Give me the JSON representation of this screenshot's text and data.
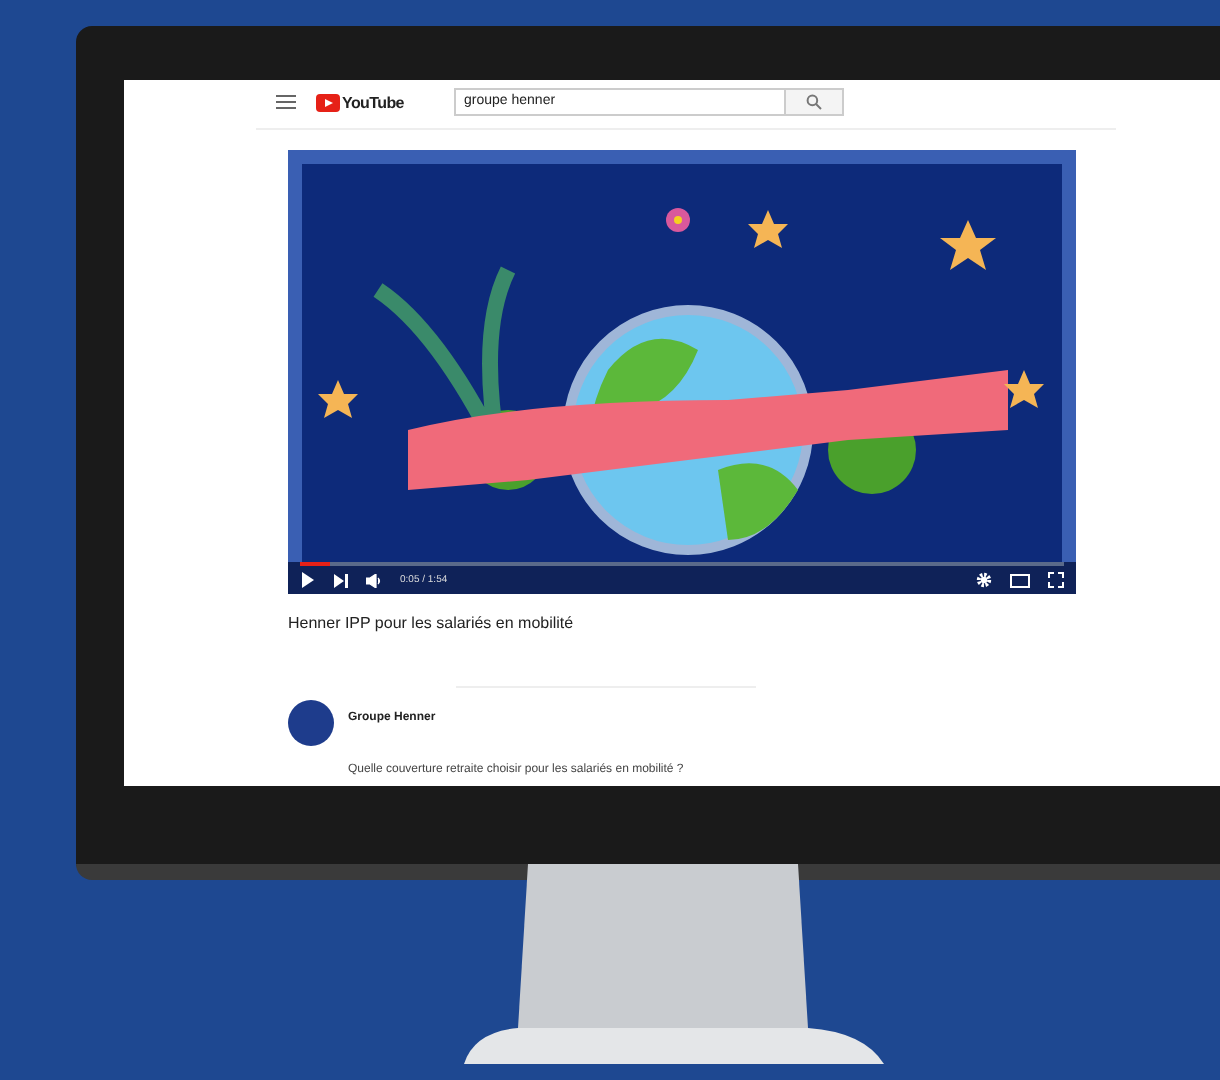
{
  "header": {
    "logo": "YouTube",
    "search": {
      "value": "groupe henner"
    }
  },
  "player": {
    "playing": false,
    "level": 0.04,
    "time": "0:05 / 1:54"
  },
  "video": {
    "title": "Henner IPP pour les salariés en mobilité"
  },
  "channel": {
    "name": "Groupe Henner",
    "description": "Quelle couverture retraite choisir pour les salariés en mobilité ?"
  }
}
